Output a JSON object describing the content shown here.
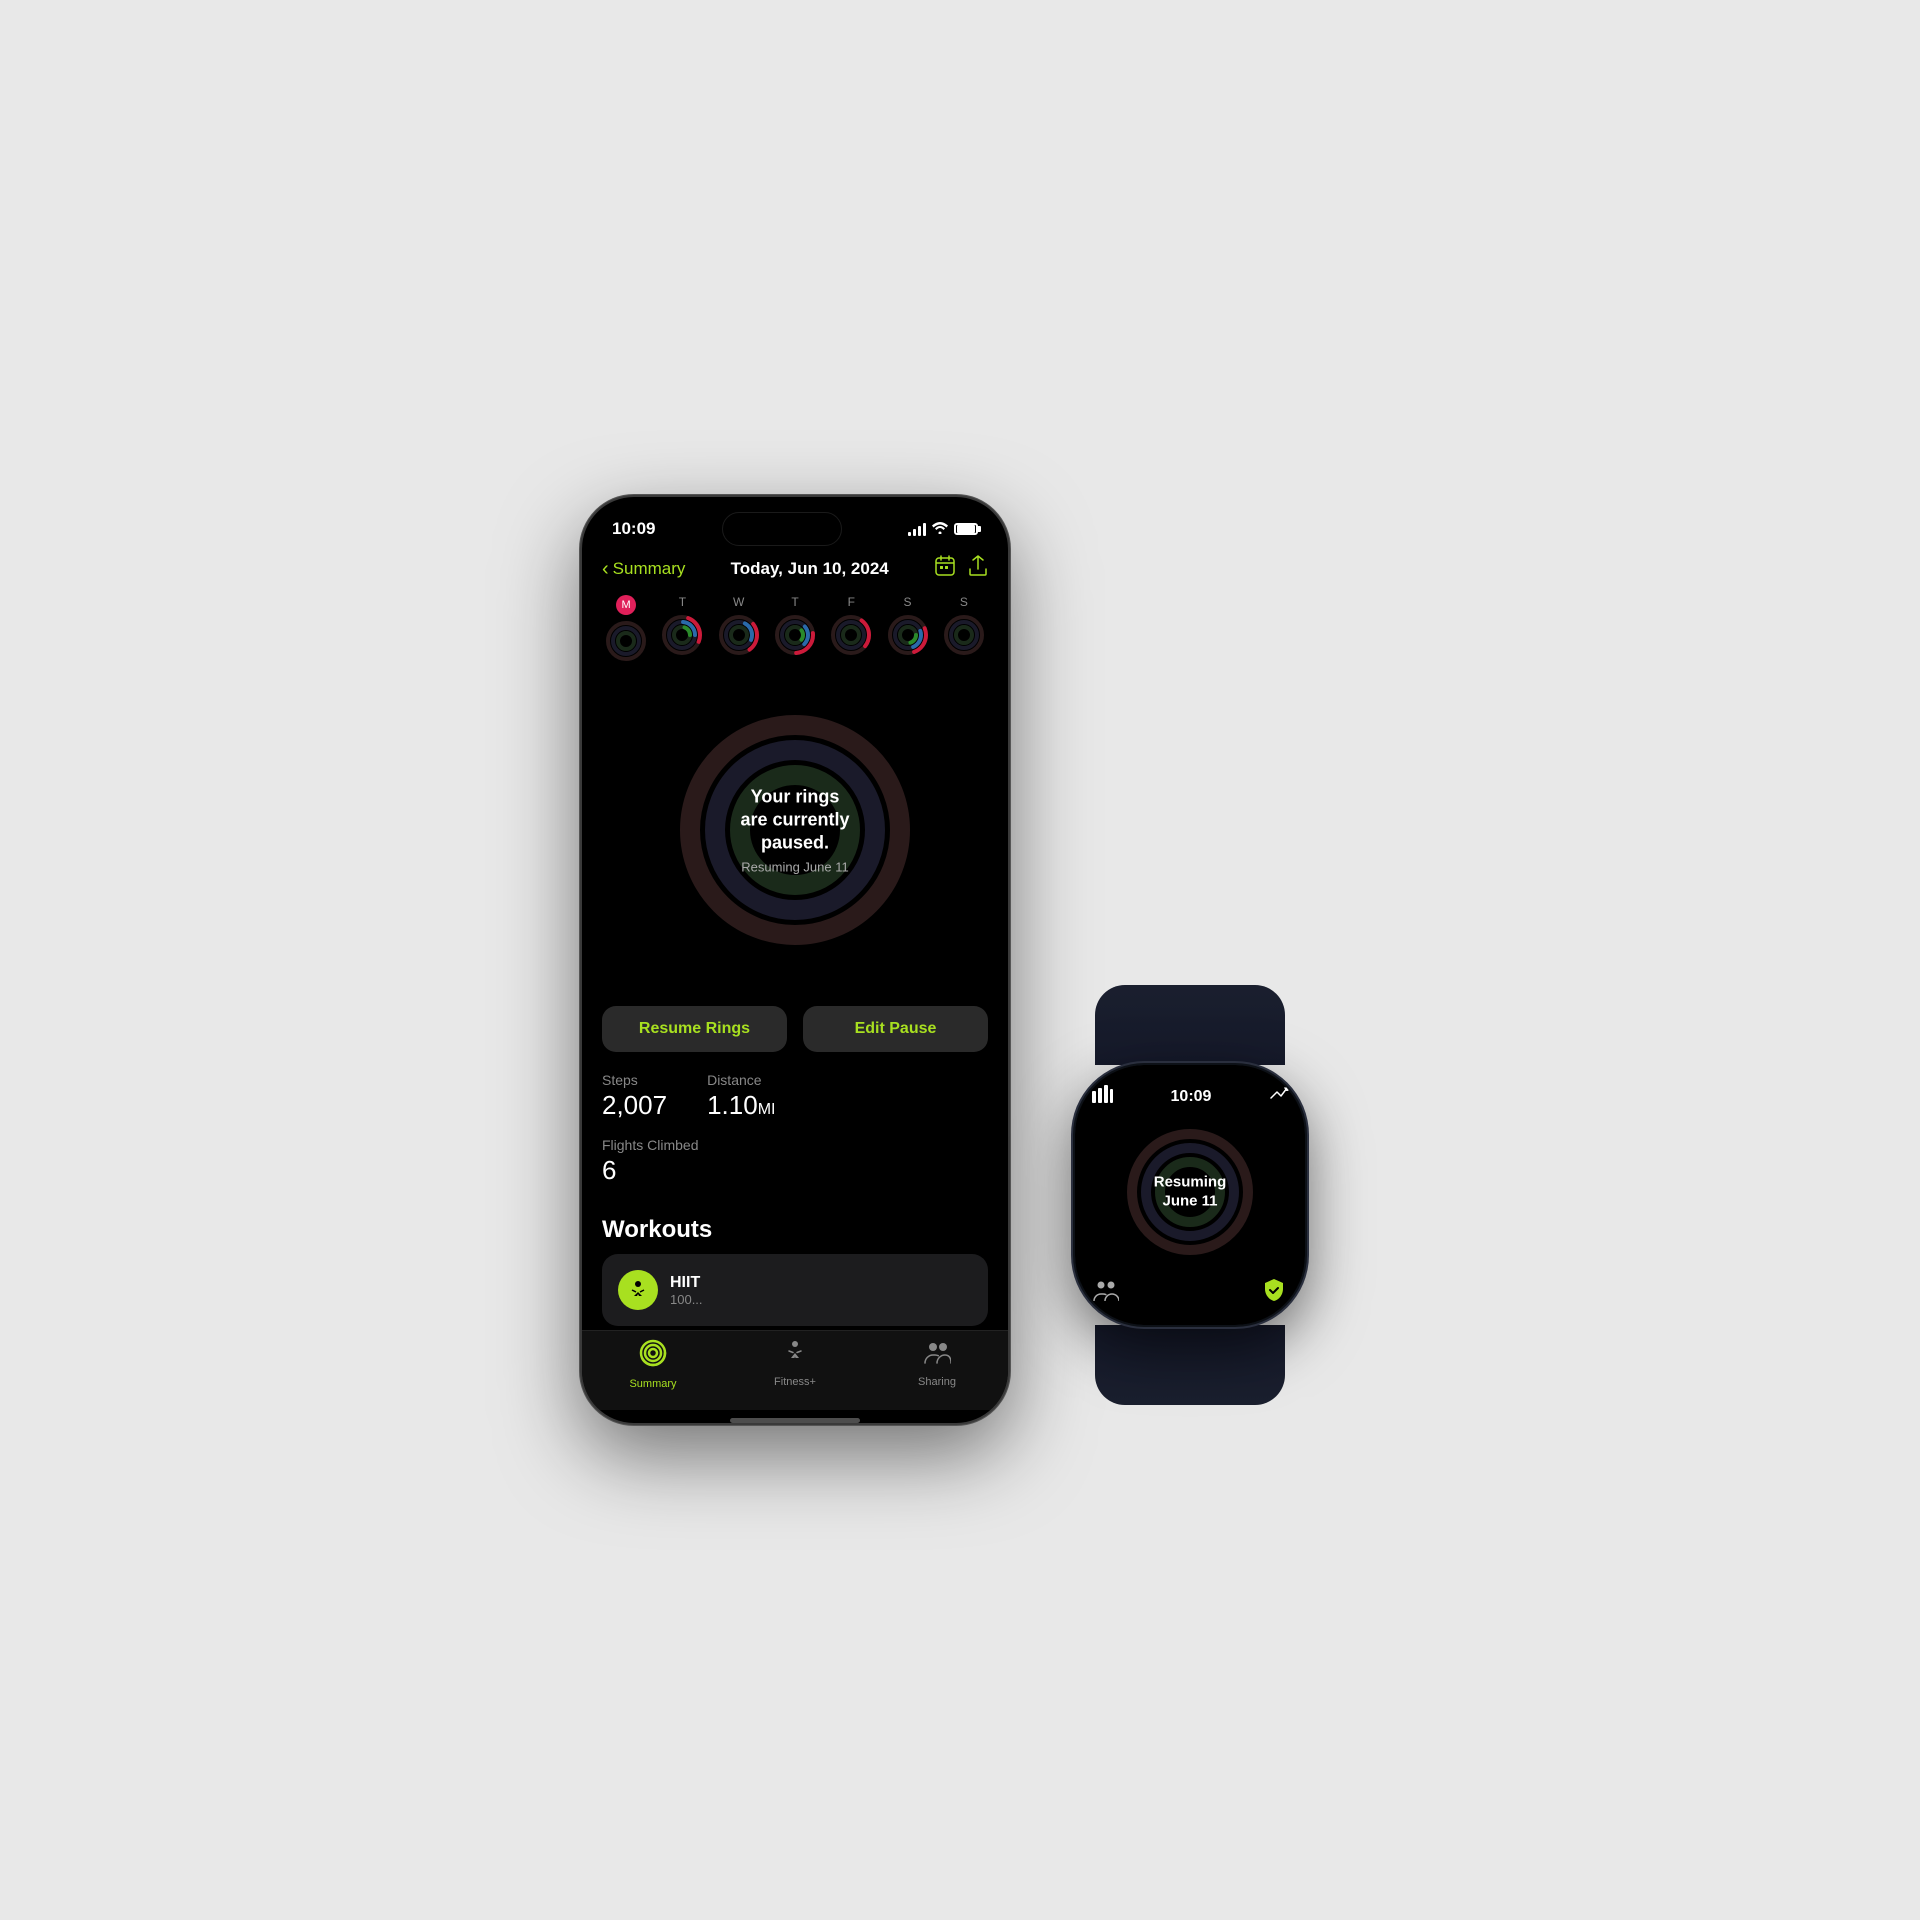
{
  "scene": {
    "background": "#e8e8e8"
  },
  "iphone": {
    "status_bar": {
      "time": "10:09",
      "signal": "●●●",
      "wifi": "wifi",
      "battery": "battery"
    },
    "header": {
      "back_label": "Summary",
      "date": "Today, Jun 10, 2024",
      "calendar_icon": "📅",
      "share_icon": "↑"
    },
    "week": {
      "days": [
        {
          "label": "M",
          "active": true
        },
        {
          "label": "T",
          "active": false
        },
        {
          "label": "W",
          "active": false
        },
        {
          "label": "T",
          "active": false
        },
        {
          "label": "F",
          "active": false
        },
        {
          "label": "S",
          "active": false
        },
        {
          "label": "S",
          "active": false
        }
      ]
    },
    "rings": {
      "main_text": "Your rings are currently paused.",
      "sub_text": "Resuming June 11",
      "outer_color": "#555",
      "middle_color": "#444",
      "inner_color": "#333"
    },
    "buttons": {
      "resume": "Resume Rings",
      "edit": "Edit Pause"
    },
    "stats": {
      "steps_label": "Steps",
      "steps_value": "2,007",
      "distance_label": "Distance",
      "distance_value": "1.10",
      "distance_unit": "MI",
      "flights_label": "Flights Climbed",
      "flights_value": "6"
    },
    "workouts": {
      "title": "Workouts",
      "items": [
        {
          "name": "HIIT",
          "icon": "🏃",
          "detail": "100..."
        }
      ]
    },
    "tab_bar": {
      "items": [
        {
          "label": "Summary",
          "active": true,
          "icon": "⭕"
        },
        {
          "label": "Fitness+",
          "active": false,
          "icon": "🏃"
        },
        {
          "label": "Sharing",
          "active": false,
          "icon": "👥"
        }
      ]
    }
  },
  "watch": {
    "status_bar": {
      "time": "10:09",
      "chart_icon": "📊",
      "trend_icon": "📈"
    },
    "ring": {
      "text_line1": "Resuming",
      "text_line2": "June 11"
    },
    "bottom_icons": {
      "left": "👥",
      "right": "🛡"
    }
  }
}
